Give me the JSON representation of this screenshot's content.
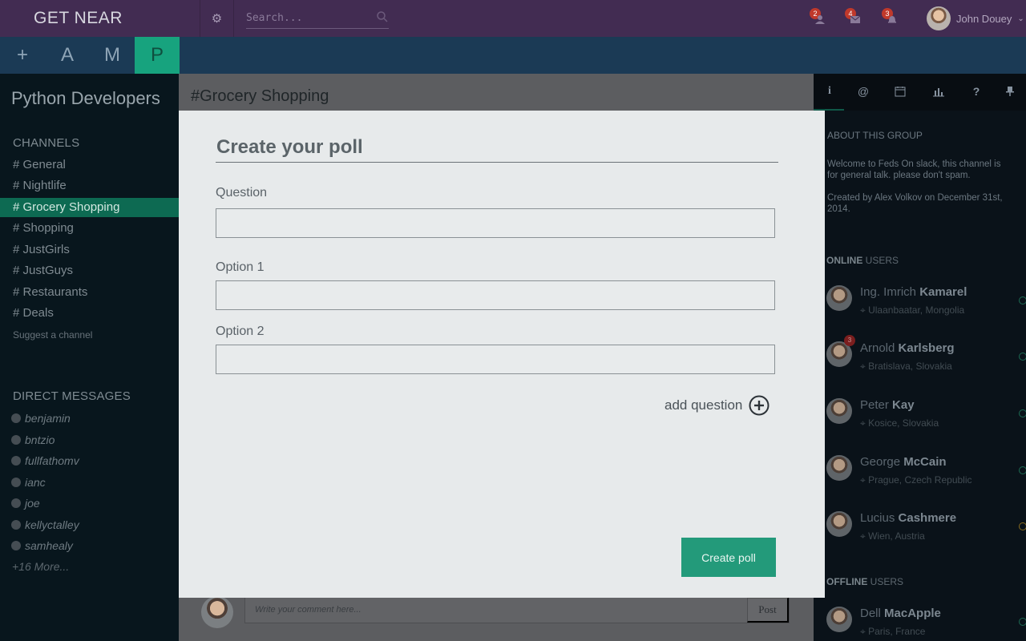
{
  "topbar": {
    "brand": "GET NEAR",
    "search_placeholder": "Search...",
    "notifications": [
      {
        "icon": "user-icon",
        "count": "2"
      },
      {
        "icon": "messages-icon",
        "count": "4"
      },
      {
        "icon": "bell-icon",
        "count": "3"
      }
    ],
    "user_name": "John Douey"
  },
  "tabstrip": {
    "items": [
      "+",
      "A",
      "M",
      "P"
    ],
    "active": "P"
  },
  "sidebar": {
    "group_title": "Python Developers",
    "channels_heading": "CHANNELS",
    "channels": [
      "# General",
      "# Nightlife",
      "# Grocery Shopping",
      "# Shopping",
      "# JustGirls",
      "# JustGuys",
      "# Restaurants",
      "# Deals"
    ],
    "active_channel": "# Grocery Shopping",
    "suggest": "Suggest a channel",
    "dm_heading": "DIRECT MESSAGES",
    "direct_messages": [
      "benjamin",
      "bntzio",
      "fullfathomv",
      "ianc",
      "joe",
      "kellyctalley",
      "samhealy"
    ],
    "more": "+16 More..."
  },
  "center": {
    "channel_title": "#Grocery Shopping",
    "comment_placeholder": "Write your comment here...",
    "post_label": "Post"
  },
  "right_panel": {
    "tabs": [
      "info-icon",
      "at-icon",
      "calendar-icon",
      "chart-icon",
      "help-icon",
      "pin-icon"
    ],
    "about_title": "ABOUT THIS GROUP",
    "about_text": "Welcome to Feds On slack, this channel is for general talk. please don't spam.",
    "created_text": "Created by Alex Volkov on December 31st, 2014.",
    "online_head_bold": "ONLINE",
    "online_head_rest": " USERS",
    "online_users": [
      {
        "first": "Ing. Imrich ",
        "last": "Kamarel",
        "location": "Ulaanbaatar, Mongolia",
        "status": "online",
        "badge": ""
      },
      {
        "first": "Arnold ",
        "last": "Karlsberg",
        "location": "Bratislava, Slovakia",
        "status": "online",
        "badge": "3"
      },
      {
        "first": "Peter ",
        "last": "Kay",
        "location": "Kosice, Slovakia",
        "status": "online",
        "badge": ""
      },
      {
        "first": "George ",
        "last": "McCain",
        "location": "Prague, Czech Republic",
        "status": "online",
        "badge": ""
      },
      {
        "first": "Lucius ",
        "last": "Cashmere",
        "location": "Wien, Austria",
        "status": "away",
        "badge": ""
      }
    ],
    "offline_head_bold": "OFFLINE",
    "offline_head_rest": " USERS",
    "offline_users": [
      {
        "first": "Dell ",
        "last": "MacApple",
        "location": "Paris, France",
        "status": "online",
        "badge": ""
      }
    ]
  },
  "modal": {
    "title": "Create your poll",
    "question_label": "Question",
    "option1_label": "Option 1",
    "option2_label": "Option 2",
    "question_value": "",
    "option1_value": "",
    "option2_value": "",
    "add_question": "add question",
    "create_button": "Create poll"
  },
  "colors": {
    "accent": "#239a7a",
    "topbar": "#422c52",
    "modal_bg": "#e7eaeb"
  }
}
